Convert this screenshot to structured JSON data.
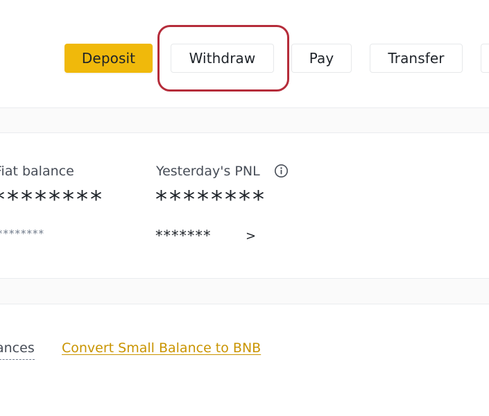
{
  "header": {
    "buttons": {
      "deposit": "Deposit",
      "withdraw": "Withdraw",
      "pay": "Pay",
      "transfer": "Transfer"
    },
    "highlighted_button": "withdraw",
    "highlight_color": "#b52c3a",
    "primary_color": "#f0b90b"
  },
  "balances": {
    "fiat": {
      "label": "Fiat balance",
      "value": "********",
      "sub_value": "********"
    },
    "pnl": {
      "label": "Yesterday's PNL",
      "icon": "info-icon",
      "value": "********",
      "sub_value": "*******",
      "chevron": ">"
    }
  },
  "footer": {
    "small_balances_label": "ances",
    "convert_link": "Convert Small Balance to BNB",
    "link_color": "#c99400"
  }
}
